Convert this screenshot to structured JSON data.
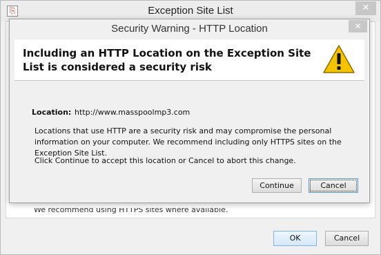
{
  "outer_window": {
    "title": "Exception Site List",
    "close_glyph": "✕",
    "app_icon_glyph": "⎘",
    "behind_text": "We recommend using HTTPS sites where available.",
    "ok_label": "OK",
    "cancel_label": "Cancel"
  },
  "dialog": {
    "title": "Security Warning - HTTP Location",
    "close_glyph": "✕",
    "heading": "Including an HTTP Location on the Exception Site List is considered a security risk",
    "icon": "warning-icon",
    "location_label": "Location:",
    "location_value": "http://www.masspoolmp3.com",
    "message": "Locations that use HTTP are a security risk and may compromise the personal information on your computer.  We recommend including only HTTPS sites on the Exception Site List.",
    "instruction": "Click Continue to accept this location or Cancel to abort this change.",
    "continue_label": "Continue",
    "cancel_label": "Cancel"
  },
  "colors": {
    "warning_yellow": "#f5c400",
    "focus_blue": "#5b9bd5"
  }
}
